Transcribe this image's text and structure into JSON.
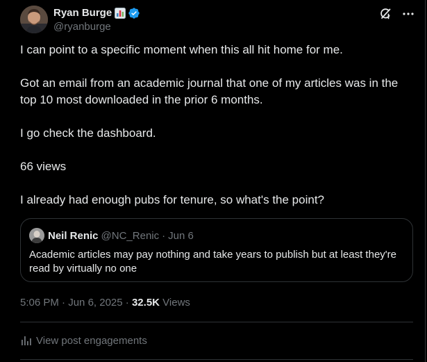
{
  "author": {
    "display_name": "Ryan Burge",
    "handle": "@ryanburge",
    "emoji_icon": "bar-chart-emoji",
    "verified_icon": "verified-badge-icon",
    "verified_color": "#1d9bf0"
  },
  "toolbar": {
    "grok_icon": "grok-icon",
    "more_icon": "more-options-icon"
  },
  "post": {
    "paragraphs": [
      "I can point to a specific moment when this all hit home for me.",
      "Got an email from an academic journal that one of my articles was in the top 10 most downloaded in the prior 6 months.",
      "I go check the dashboard.",
      "66 views",
      "I already had enough pubs for tenure, so what's the point?"
    ]
  },
  "quote": {
    "name": "Neil Renic",
    "handle": "@NC_Renic",
    "separator": "·",
    "date": "Jun 6",
    "text": "Academic articles may pay nothing and take years to publish but at least they're read by virtually no one"
  },
  "meta": {
    "time": "5:06 PM",
    "separator": "·",
    "date": "Jun 6, 2025",
    "views_count": "32.5K",
    "views_label": "Views"
  },
  "engagements": {
    "label": "View post engagements",
    "icon": "analytics-bars-icon"
  },
  "colors": {
    "background": "#000000",
    "text_primary": "#e7e9ea",
    "text_secondary": "#71767b",
    "border": "#2f3336"
  }
}
